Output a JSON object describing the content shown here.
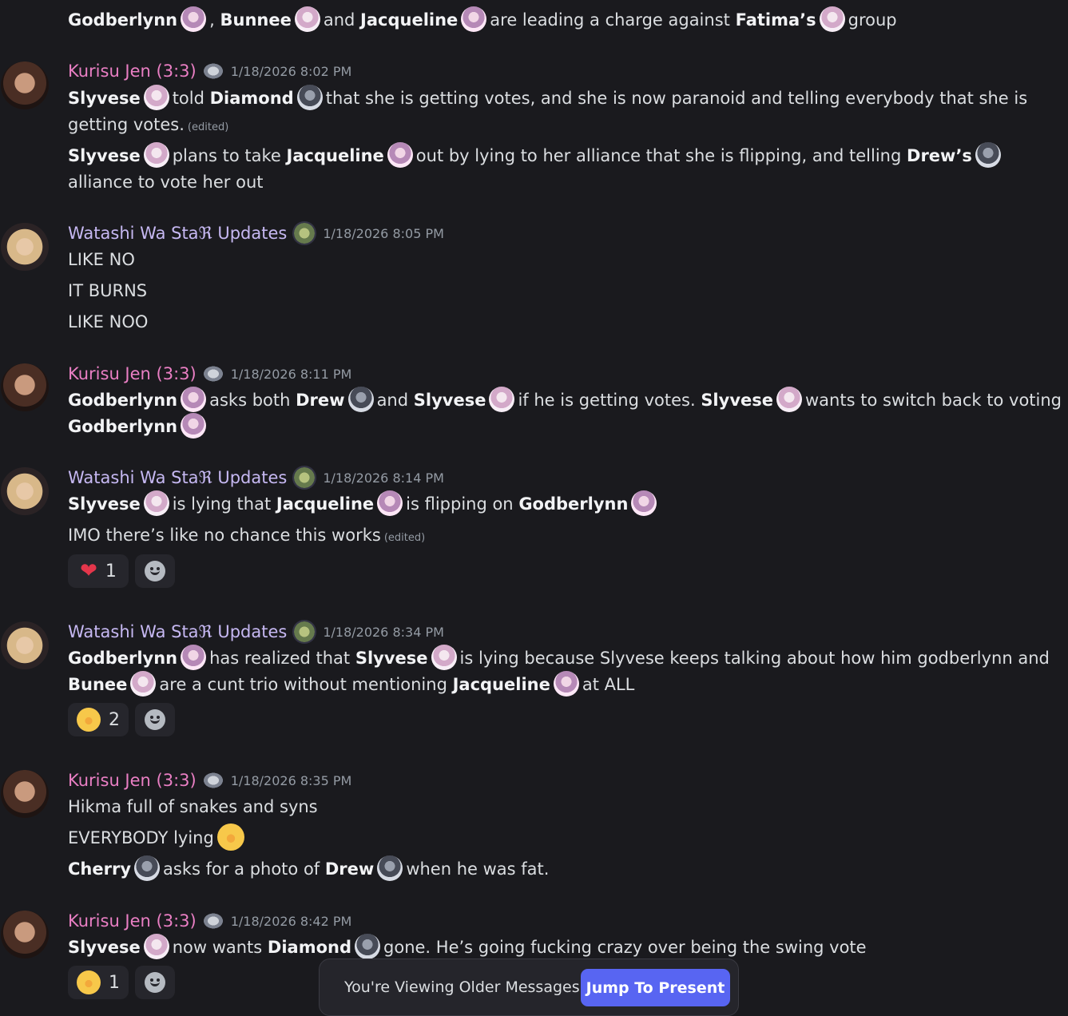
{
  "authors": {
    "kurisu": "Kurisu Jen (3:3)",
    "watashi": "Watashi Wa Staℜ Updates"
  },
  "m0": {
    "l1": {
      "a": "Godberlynn",
      "b": ",",
      "c": "Bunnee",
      "d": "and",
      "e": "Jacqueline",
      "f": "are leading a charge against",
      "g": "Fatima’s",
      "h": "group"
    }
  },
  "m1": {
    "time": "1/18/2026 8:02 PM",
    "l1": {
      "a": "Slyvese",
      "b": "told",
      "c": "Diamond",
      "d": "that she is getting votes, and she is now paranoid and telling everybody that she is"
    },
    "l2": {
      "a": "getting votes.",
      "edited": "(edited)"
    },
    "l3": {
      "a": "Slyvese",
      "b": "plans to take",
      "c": "Jacqueline",
      "d": "out by lying to her alliance that she is flipping, and telling",
      "e": "Drew’s"
    },
    "l4": {
      "a": "alliance to vote her out"
    }
  },
  "m2": {
    "time": "1/18/2026 8:05 PM",
    "l1": "LIKE NO",
    "l2": "IT BURNS",
    "l3": "LIKE NOO"
  },
  "m3": {
    "time": "1/18/2026 8:11 PM",
    "l1": {
      "a": "Godberlynn",
      "b": "asks both",
      "c": "Drew",
      "d": "and",
      "e": "Slyvese",
      "f": "if he is getting votes.",
      "g": "Slyvese",
      "h": "wants to switch back to voting"
    },
    "l2": {
      "a": "Godberlynn"
    }
  },
  "m4": {
    "time": "1/18/2026 8:14 PM",
    "l1": {
      "a": "Slyvese",
      "b": "is lying that",
      "c": "Jacqueline",
      "d": "is flipping on",
      "e": "Godberlynn"
    },
    "l2": {
      "a": "IMO there’s like no chance this works",
      "edited": "(edited)"
    },
    "reaction_count": "1"
  },
  "m5": {
    "time": "1/18/2026 8:34 PM",
    "l1": {
      "a": "Godberlynn",
      "b": "has realized that",
      "c": "Slyvese",
      "d": "is lying because Slyvese keeps talking about how him godberlynn and"
    },
    "l2": {
      "a": "Bunee",
      "b": "are a cunt trio without mentioning",
      "c": "Jacqueline",
      "d": "at ALL"
    },
    "reaction_count": "2"
  },
  "m6": {
    "time": "1/18/2026 8:35 PM",
    "l1": "Hikma full of snakes and syns",
    "l2": "EVERYBODY lying",
    "l3": {
      "a": "Cherry",
      "b": "asks for a photo of",
      "c": "Drew",
      "d": "when he was fat."
    }
  },
  "m7": {
    "time": "1/18/2026 8:42 PM",
    "l1": {
      "a": "Slyvese",
      "b": "now wants",
      "c": "Diamond",
      "d": "gone. He’s going fucking crazy over being the swing vote"
    },
    "reaction_count": "1"
  },
  "banner": {
    "text": "You're Viewing Older Messages",
    "button": "Jump To Present"
  },
  "icons": {
    "reaction_heart": "red-heart-icon",
    "reaction_sob": "loudly-crying-face-icon",
    "add_reaction": "add-reaction-smiley-icon",
    "role_badge": "role-badge-icon"
  },
  "colors": {
    "background": "#1a1a1e",
    "kurisu_name": "#ea7fc4",
    "watashi_name": "#c6b8f2",
    "accent": "#5865f2"
  }
}
